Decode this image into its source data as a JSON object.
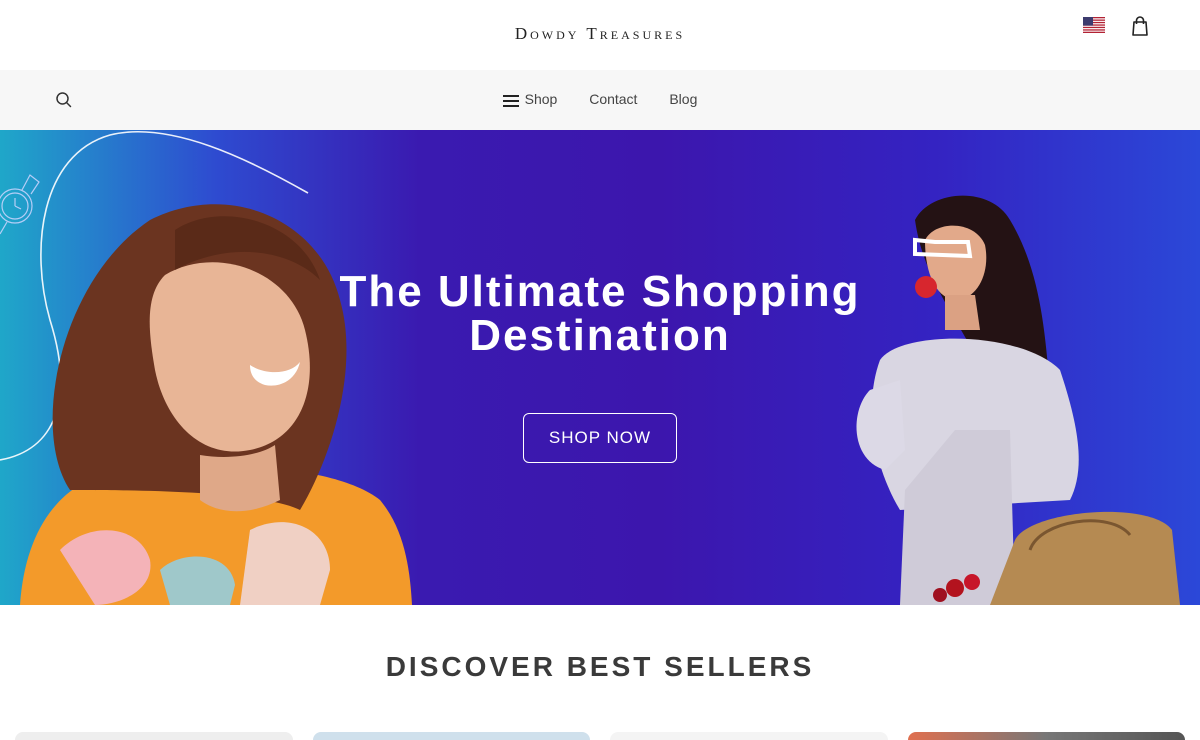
{
  "header": {
    "brand": "Dowdy Treasures",
    "locale_icon": "us-flag-icon",
    "cart_icon": "shopping-bag-icon"
  },
  "nav": {
    "search_icon": "search-icon",
    "menu_icon": "hamburger-menu-icon",
    "items": [
      {
        "label": "Shop"
      },
      {
        "label": "Contact"
      },
      {
        "label": "Blog"
      }
    ]
  },
  "hero": {
    "title_line1": "The Ultimate Shopping",
    "title_line2": "Destination",
    "cta_label": "SHOP NOW"
  },
  "best_sellers": {
    "title": "DISCOVER BEST SELLERS"
  },
  "colors": {
    "hero_primary": "#3c16ad",
    "hero_left": "#1fa7c9",
    "hero_right": "#2b48d8",
    "navbar_bg": "#f7f7f7",
    "text_dark": "#3a3a3a"
  }
}
